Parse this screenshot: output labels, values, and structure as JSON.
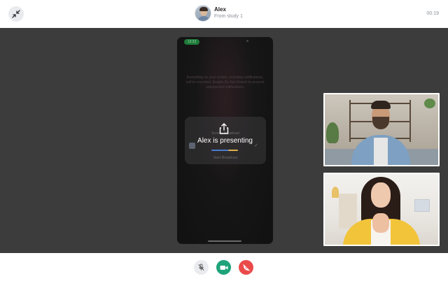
{
  "header": {
    "caller_name": "Alex",
    "caller_subtitle": "From study 1",
    "call_timer": "00:19",
    "collapse_icon": "collapse-arrows-icon"
  },
  "shared_screen": {
    "status_time": "13:33",
    "notice": "Everything on your screen, including notifications, will be recorded. Enable Do Not Disturb to prevent unexpected notifications.",
    "sheet_title": "Screen Broadcast",
    "sheet_button": "Start Broadcast",
    "overlay_icon": "share-icon",
    "presenting_text": "Alex  is presenting"
  },
  "participants": [
    {
      "label": "alex-video-tile"
    },
    {
      "label": "participant-video-tile"
    }
  ],
  "controls": {
    "mic": {
      "icon": "mic-off-icon",
      "color": "#e9ebee"
    },
    "camera": {
      "icon": "video-camera-icon",
      "color": "#1fa37a"
    },
    "end_call": {
      "icon": "end-call-icon",
      "color": "#ea4a4a"
    }
  }
}
